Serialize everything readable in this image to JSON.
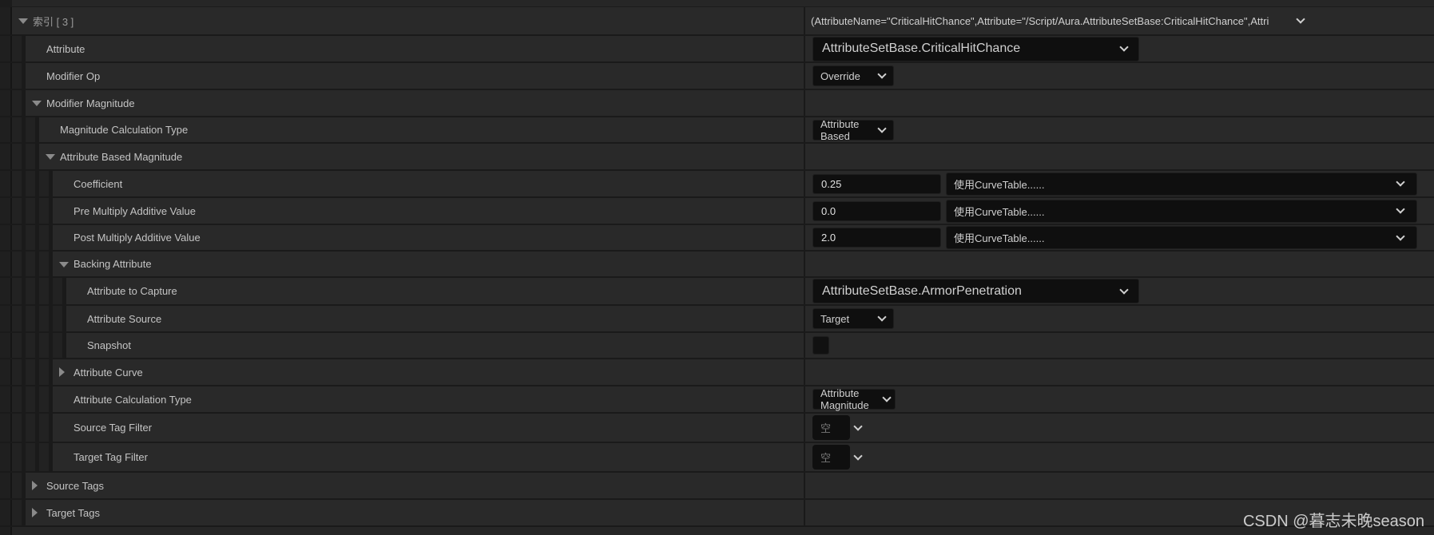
{
  "rows": [
    {
      "label": "索引 [ 3 ]",
      "depth": 0,
      "arrow": "down",
      "value": {
        "type": "header",
        "text": "(AttributeName=\"CriticalHitChance\",Attribute=\"/Script/Aura.AttributeSetBase:CriticalHitChance\",Attri"
      }
    },
    {
      "label": "Attribute",
      "depth": 1,
      "value": {
        "type": "big",
        "text": "AttributeSetBase.CriticalHitChance"
      }
    },
    {
      "label": "Modifier Op",
      "depth": 1,
      "value": {
        "type": "small",
        "text": "Override"
      }
    },
    {
      "label": "Modifier Magnitude",
      "depth": 1,
      "arrow": "down"
    },
    {
      "label": "Magnitude Calculation Type",
      "depth": 2,
      "value": {
        "type": "small",
        "text": "Attribute Based"
      }
    },
    {
      "label": "Attribute Based Magnitude",
      "depth": 2,
      "arrow": "down"
    },
    {
      "label": "Coefficient",
      "depth": 3,
      "value": {
        "type": "num",
        "text": "0.25",
        "curve": "使用CurveTable......"
      }
    },
    {
      "label": "Pre Multiply Additive Value",
      "depth": 3,
      "value": {
        "type": "num",
        "text": "0.0",
        "curve": "使用CurveTable......"
      }
    },
    {
      "label": "Post Multiply Additive Value",
      "depth": 3,
      "value": {
        "type": "num",
        "text": "2.0",
        "curve": "使用CurveTable......"
      }
    },
    {
      "label": "Backing Attribute",
      "depth": 3,
      "arrow": "down"
    },
    {
      "label": "Attribute to Capture",
      "depth": 4,
      "value": {
        "type": "big",
        "text": "AttributeSetBase.ArmorPenetration"
      }
    },
    {
      "label": "Attribute Source",
      "depth": 4,
      "value": {
        "type": "small",
        "text": "Target"
      }
    },
    {
      "label": "Snapshot",
      "depth": 4,
      "value": {
        "type": "checkbox",
        "checked": false
      }
    },
    {
      "label": "Attribute Curve",
      "depth": 3,
      "arrow": "right"
    },
    {
      "label": "Attribute Calculation Type",
      "depth": 3,
      "value": {
        "type": "small",
        "text": "Attribute Magnitude"
      }
    },
    {
      "label": "Source Tag Filter",
      "depth": 3,
      "value": {
        "type": "tag",
        "text": "空"
      }
    },
    {
      "label": "Target Tag Filter",
      "depth": 3,
      "value": {
        "type": "tag",
        "text": "空"
      }
    },
    {
      "label": "Source Tags",
      "depth": 1,
      "arrow": "right"
    },
    {
      "label": "Target Tags",
      "depth": 1,
      "arrow": "right"
    }
  ],
  "watermark": "CSDN @暮志未晚season"
}
